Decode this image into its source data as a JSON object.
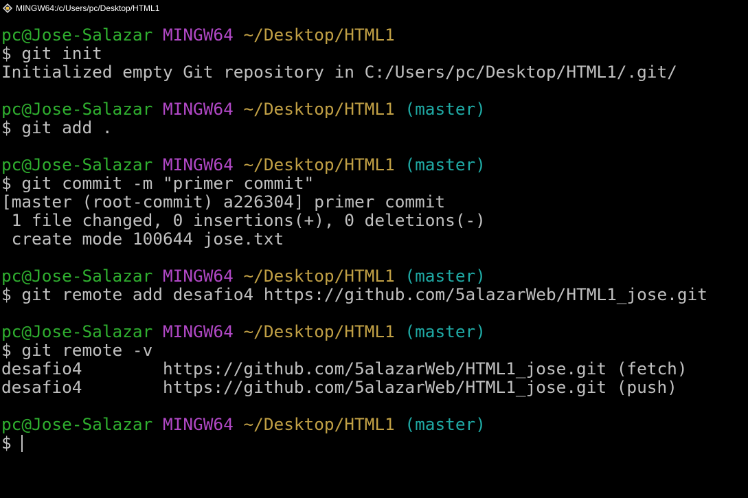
{
  "window": {
    "title": "MINGW64:/c/Users/pc/Desktop/HTML1",
    "icon": "git-bash-icon"
  },
  "colors": {
    "background": "#000000",
    "user_host": "#2faf2f",
    "system": "#b148c6",
    "path": "#c1a045",
    "branch": "#1faaa5",
    "text": "#c0c0c0"
  },
  "prompt": {
    "user_host": "pc@Jose-Salazar",
    "system": "MINGW64",
    "path": "~/Desktop/HTML1",
    "branch": "(master)",
    "symbol": "$"
  },
  "blocks": [
    {
      "has_branch": false,
      "command": "git init",
      "output": [
        "Initialized empty Git repository in C:/Users/pc/Desktop/HTML1/.git/"
      ]
    },
    {
      "has_branch": true,
      "command": "git add .",
      "output": []
    },
    {
      "has_branch": true,
      "command": "git commit -m \"primer commit\"",
      "output": [
        "[master (root-commit) a226304] primer commit",
        " 1 file changed, 0 insertions(+), 0 deletions(-)",
        " create mode 100644 jose.txt"
      ]
    },
    {
      "has_branch": true,
      "command": "git remote add desafio4 https://github.com/5alazarWeb/HTML1_jose.git",
      "output": []
    },
    {
      "has_branch": true,
      "command": "git remote -v",
      "output": [
        "desafio4        https://github.com/5alazarWeb/HTML1_jose.git (fetch)",
        "desafio4        https://github.com/5alazarWeb/HTML1_jose.git (push)"
      ]
    },
    {
      "has_branch": true,
      "command": "",
      "output": [],
      "is_current": true
    }
  ]
}
